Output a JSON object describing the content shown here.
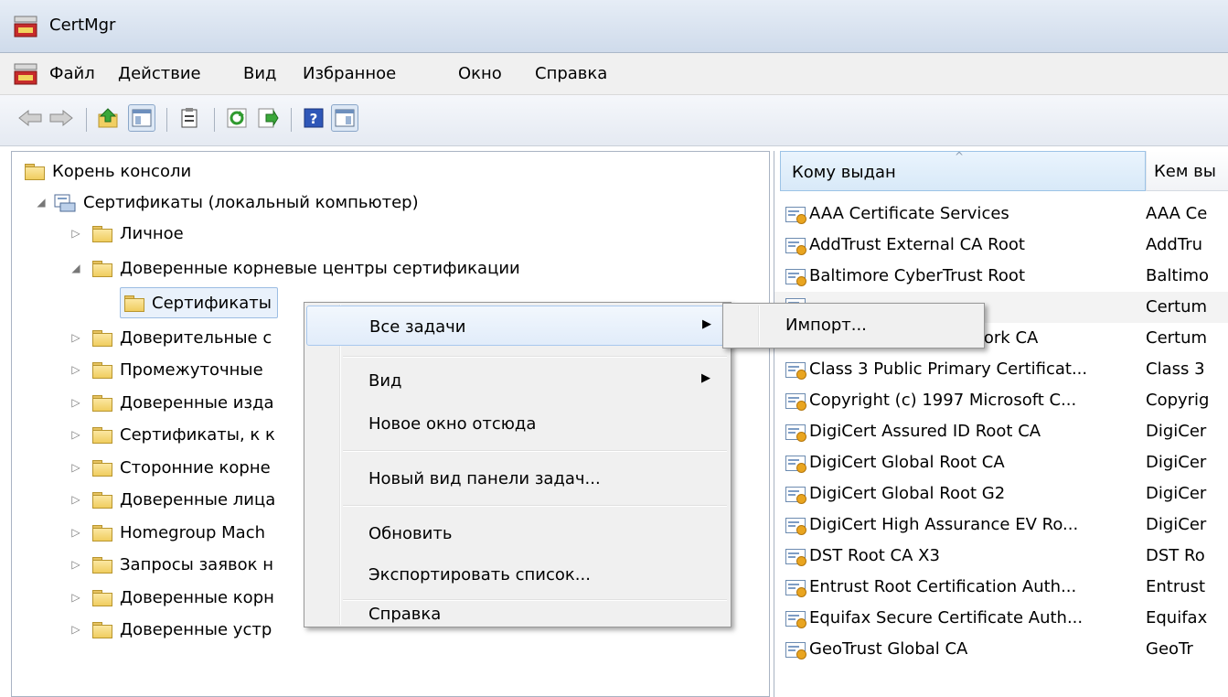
{
  "window": {
    "title": "CertMgr"
  },
  "menu": {
    "items": [
      "Файл",
      "Действие",
      "Вид",
      "Избранное",
      "Окно",
      "Справка"
    ]
  },
  "toolbar": {
    "buttons": [
      "back-icon",
      "forward-icon",
      "up-level-icon",
      "show-hide-console-tree-icon",
      "properties-icon",
      "refresh-icon",
      "export-list-icon",
      "help-icon",
      "show-hide-action-pane-icon"
    ]
  },
  "tree": {
    "root": "Корень консоли",
    "certs_local": "Сертификаты (локальный компьютер)",
    "personal": "Личное",
    "trusted_root": "Доверенные корневые центры сертификации",
    "certificates": "Сертификаты",
    "nodes": [
      "Доверительные с",
      "Промежуточные",
      "Доверенные изда",
      "Сертификаты, к к",
      "Сторонние корне",
      "Доверенные лица",
      "Homegroup Mach",
      "Запросы заявок н",
      "Доверенные корн",
      "Доверенные устр"
    ]
  },
  "list": {
    "columns": [
      "Кому выдан",
      "Кем вы"
    ],
    "rows": [
      [
        "AAA Certificate Services",
        "AAA Ce"
      ],
      [
        "AddTrust External CA Root",
        "AddTru"
      ],
      [
        "Baltimore CyberTrust Root",
        "Baltimo"
      ],
      [
        "",
        "Certum"
      ],
      [
        "Certum Trusted Network CA",
        "Certum"
      ],
      [
        "Class 3 Public Primary Certificat...",
        "Class 3"
      ],
      [
        "Copyright (c) 1997 Microsoft C...",
        "Copyrig"
      ],
      [
        "DigiCert Assured ID Root CA",
        "DigiCer"
      ],
      [
        "DigiCert Global Root CA",
        "DigiCer"
      ],
      [
        "DigiCert Global Root G2",
        "DigiCer"
      ],
      [
        "DigiCert High Assurance EV Ro...",
        "DigiCer"
      ],
      [
        "DST Root CA X3",
        "DST Ro"
      ],
      [
        "Entrust Root Certification Auth...",
        "Entrust"
      ],
      [
        "Equifax Secure Certificate Auth...",
        "Equifax"
      ],
      [
        "GeoTrust Global CA",
        "GeoTr"
      ]
    ]
  },
  "context_menu": {
    "all_tasks": "Все задачи",
    "view": "Вид",
    "new_window": "Новое окно отсюда",
    "new_taskpad": "Новый вид панели задач...",
    "refresh": "Обновить",
    "export_list": "Экспортировать список...",
    "help": "Справка",
    "submenu_arrow": "▶"
  },
  "submenu": {
    "import": "Импорт..."
  },
  "colors": {
    "selection_border": "#a8c8ee",
    "selection_bg": "#e1ecfa",
    "menu_bg": "#f0f0f0"
  }
}
